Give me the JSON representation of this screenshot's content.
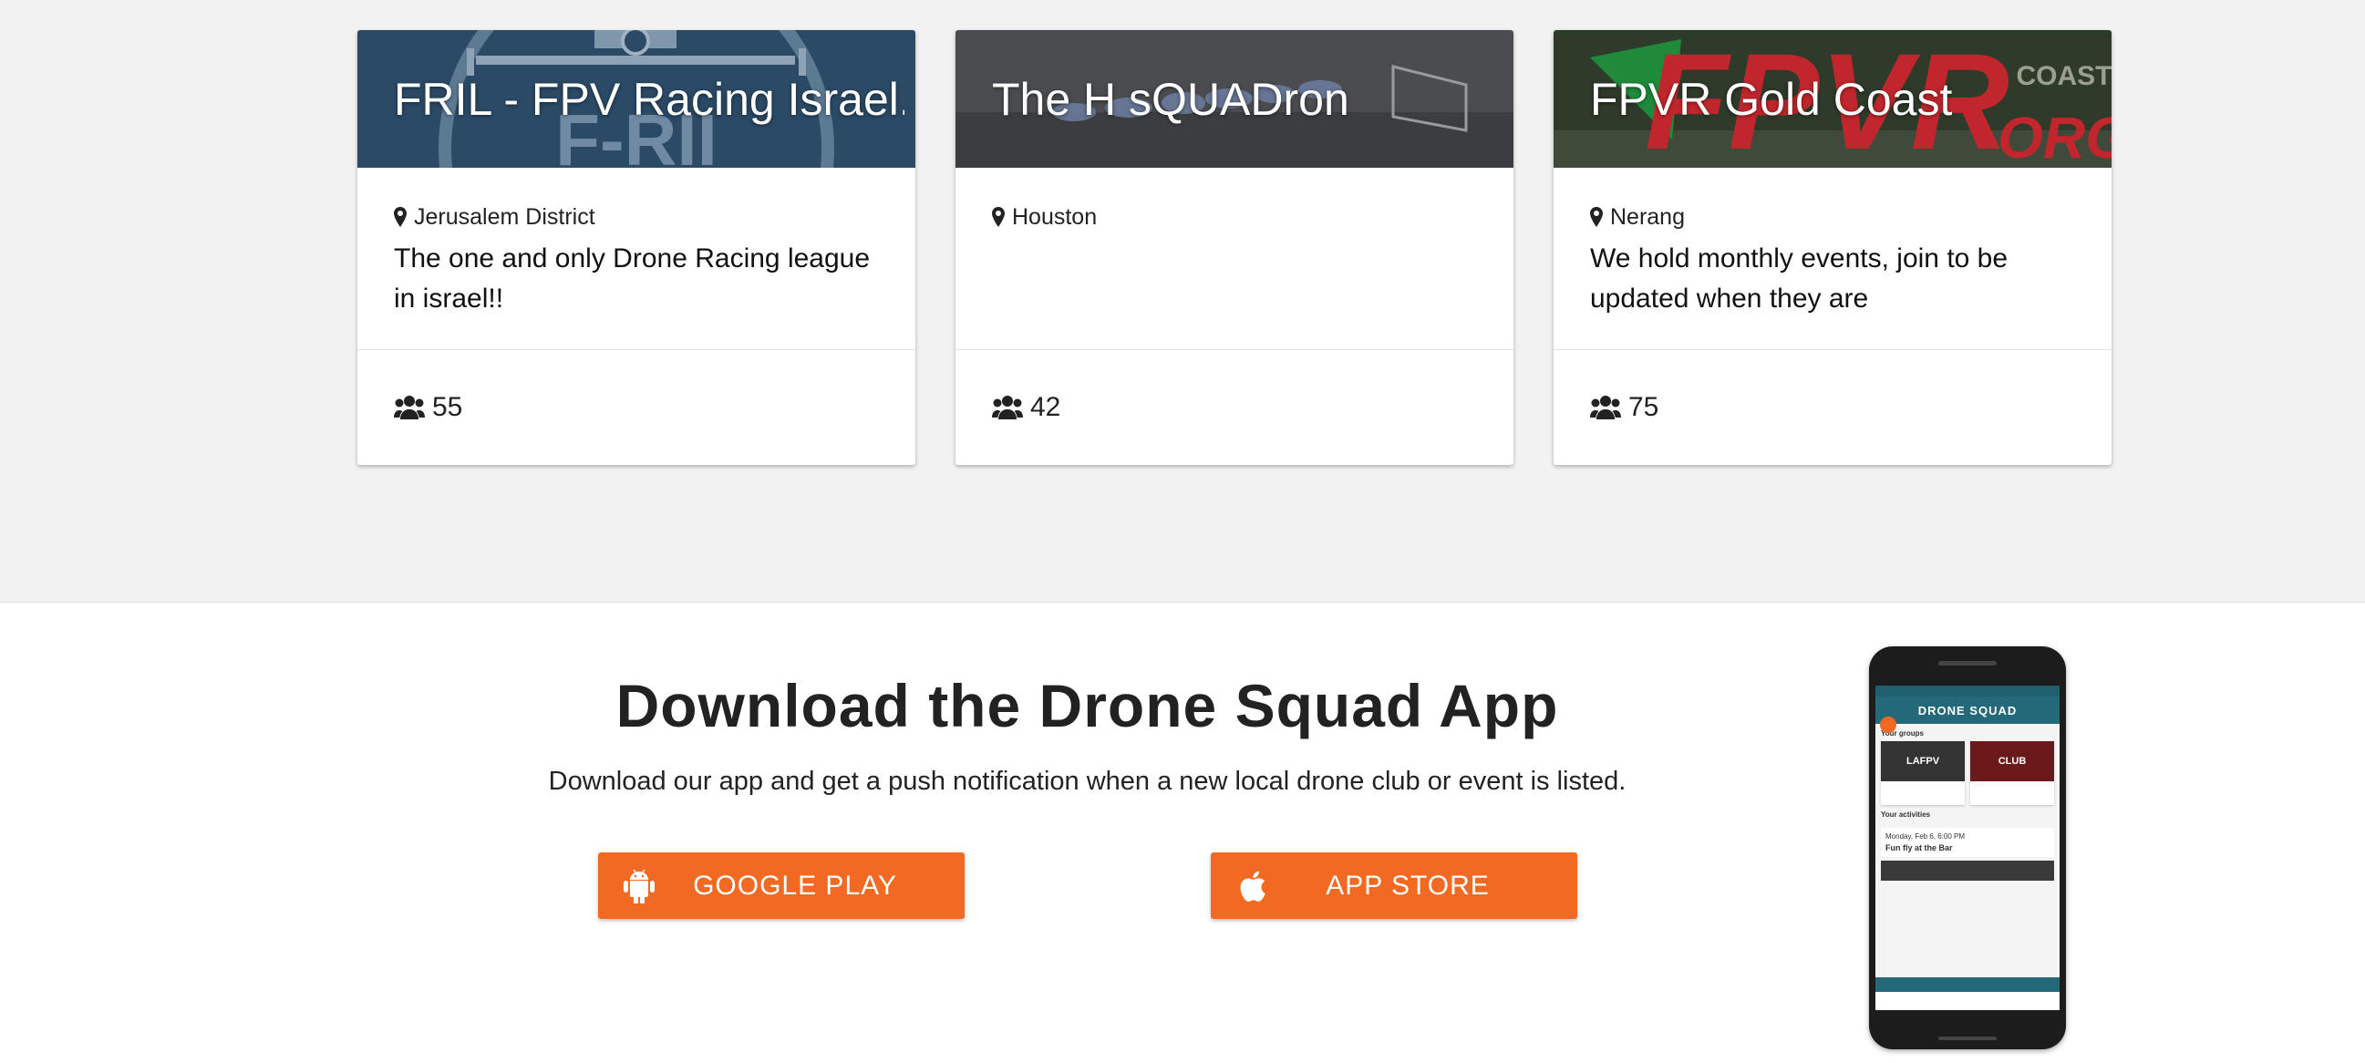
{
  "groups": [
    {
      "title": "FRIL - FPV Racing Israel...",
      "location": "Jerusalem District",
      "description": "The one and only Drone Racing league in israel!!",
      "members": "55",
      "header_color": "#2b4a66"
    },
    {
      "title": "The H sQUADron",
      "location": "Houston",
      "description": "",
      "members": "42",
      "header_color": "#4a4c50"
    },
    {
      "title": "FPVR Gold Coast",
      "location": "Nerang",
      "description": "We hold monthly events, join to be updated when they are",
      "members": "75",
      "header_color": "#5a1d1d"
    }
  ],
  "app_promo": {
    "title": "Download the Drone Squad App",
    "subtitle": "Download our app and get a push notification when a new local drone club or event is listed.",
    "google_label": "GOOGLE PLAY",
    "apple_label": "APP STORE",
    "button_color": "#f26a21"
  },
  "phone": {
    "app_name": "DRONE SQUAD",
    "groups_label": "Your groups",
    "group_1": "LAFPV",
    "group_2": "CLUB",
    "activities_label": "Your activities",
    "activity_date": "Monday, Feb 6, 6:00 PM",
    "activity_title": "Fun fly at the Bar"
  },
  "icons": {
    "location": "map-marker-icon",
    "members": "users-icon",
    "google": "android-icon",
    "apple": "apple-icon"
  }
}
